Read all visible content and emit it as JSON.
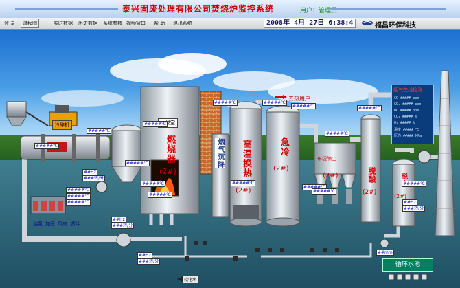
{
  "header": {
    "title": "泰兴固废处理有限公司焚烧炉监控系统",
    "subtitle": "用户：管理员",
    "brand": "福昌环保科技",
    "datetime": {
      "year": "2008",
      "y_unit": "年",
      "month": "4",
      "m_unit": "月",
      "day": "27",
      "d_unit": "日",
      "hour": "6",
      "minute": "38",
      "second": "4"
    }
  },
  "menu": {
    "items": [
      "登  录",
      "流程图",
      "实时数据",
      "历史数据",
      "系统参数",
      "视频窗口",
      "帮  助",
      "退出系统"
    ],
    "active_index": 1
  },
  "equipment": {
    "crusher": "冷碎机",
    "second_chamber": "二燃室",
    "incinerator_line1": "燃烧器",
    "incinerator_no": "(2#)",
    "smoke_settle": "烟气沉降",
    "heat_exchanger": "高温换热",
    "quench": "急冷",
    "bag_filter": "布袋除尘",
    "deacid": "脱酸",
    "desulfur": "脱水",
    "to_user": "去热用户",
    "pool": "循环水池",
    "softwater": "软化水",
    "monitor_title": "烟气在线检测"
  },
  "reagents": [
    "油泵",
    "加压",
    "风扇",
    "燃料"
  ],
  "readings": {
    "placeholder": "#####℃",
    "hz": "##Hz",
    "rpm": "###转/分",
    "pct": "##.#%",
    "mm": "##mm"
  },
  "monitor_rows": [
    {
      "name": "CO",
      "unit": "ppm"
    },
    {
      "name": "SO₂",
      "unit": "ppm"
    },
    {
      "name": "NO",
      "unit": "ppm"
    },
    {
      "name": "CO₂",
      "unit": "%"
    },
    {
      "name": "O₂",
      "unit": "%"
    },
    {
      "name": "温度",
      "unit": "℃"
    },
    {
      "name": "压力",
      "unit": "KPa"
    }
  ],
  "colors": {
    "pipe": "#d8dde3",
    "accent_red": "#d40000",
    "vessel": "#bfc6cd"
  }
}
